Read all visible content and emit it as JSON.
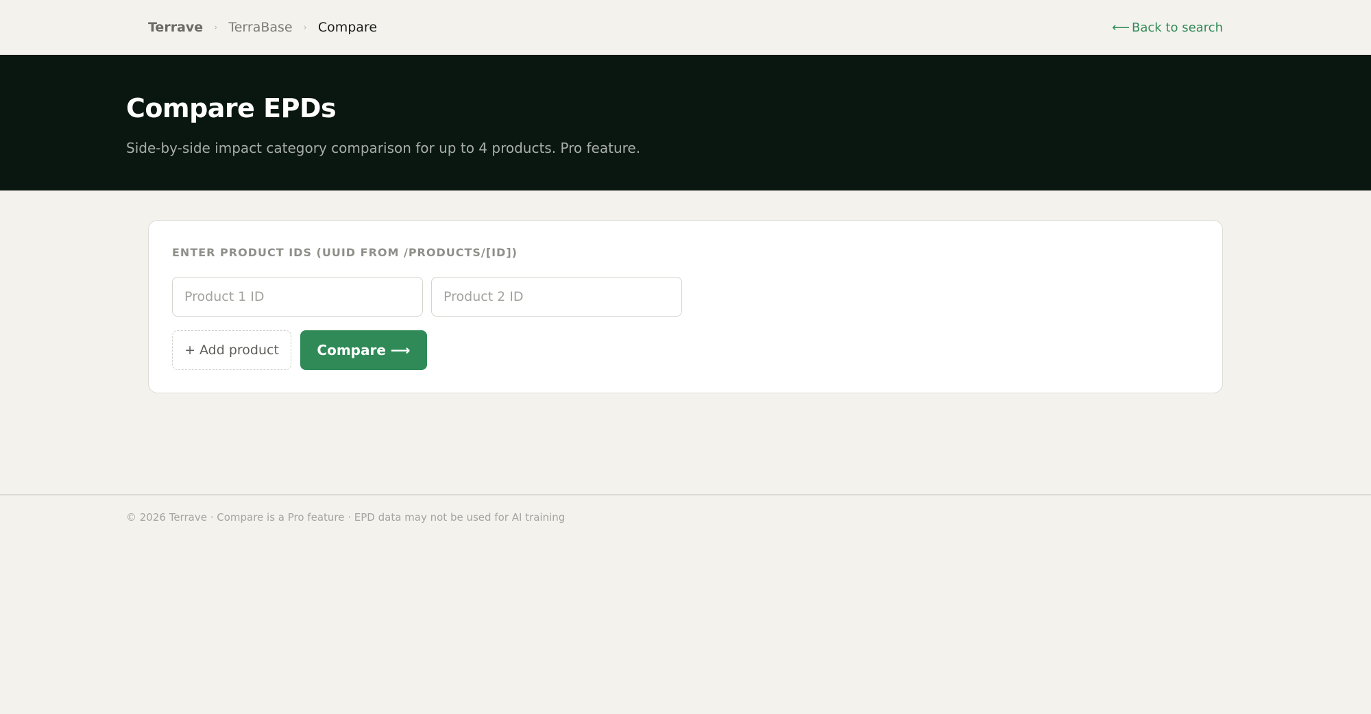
{
  "nav": {
    "breadcrumb": {
      "root": "Terrave",
      "section": "TerraBase",
      "current": "Compare",
      "separator": "›"
    },
    "back_link": {
      "arrow": "⟵",
      "label": "Back to search"
    }
  },
  "hero": {
    "title": "Compare EPDs",
    "subtitle": "Side-by-side impact category comparison for up to 4 products. Pro feature."
  },
  "form": {
    "label": "ENTER PRODUCT IDS (UUID FROM /PRODUCTS/[ID])",
    "inputs": [
      {
        "value": "",
        "placeholder": "Product 1 ID"
      },
      {
        "value": "",
        "placeholder": "Product 2 ID"
      }
    ],
    "add_button": "+ Add product",
    "compare_button": "Compare ⟶"
  },
  "footer": {
    "text": "© 2026 Terrave · Compare is a Pro feature · EPD data may not be used for AI training"
  },
  "colors": {
    "accent": "#2f8a57",
    "hero_bg": "#0a1711",
    "page_bg": "#f4f2ed"
  }
}
